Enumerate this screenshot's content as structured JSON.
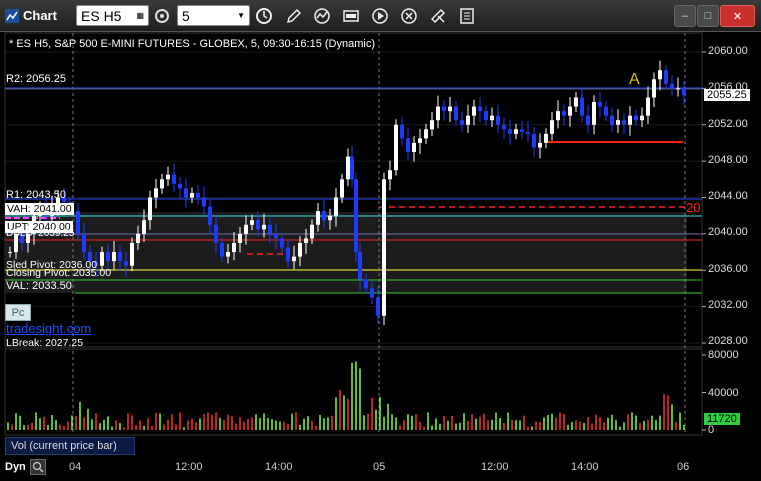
{
  "window": {
    "title": "Chart",
    "symbol": "ES H5",
    "interval": "5"
  },
  "chart": {
    "header": "* ES H5, S&P 500 E-MINI FUTURES - GLOBEX, 5, 09:30-16:15 (Dynamic)",
    "price_axis": [
      "2060.00",
      "2056.00",
      "2052.00",
      "2048.00",
      "2044.00",
      "2040.00",
      "2036.00",
      "2032.00",
      "2028.00"
    ],
    "last_price": "2055.25",
    "volume_axis": [
      "80000",
      "40000",
      "0"
    ],
    "last_volume": "11720",
    "time_axis": [
      "04",
      "12:00",
      "14:00",
      "05",
      "12:00",
      "14:00",
      "06"
    ],
    "marker_A": "A",
    "marker_20": "20",
    "volume_label": "Vol (current price bar)",
    "dyn_label": "Dyn",
    "pc_label": "Pc",
    "watermark": "tradesight.com",
    "levels": {
      "r2": "R2: 2056.25",
      "r1": "R1: 2043.50",
      "vah": "VAH: 2041.00",
      "upt": "UPT: 2040.00",
      "dbld": "DBLD: 2039.25",
      "sled": "Sled Pivot: 2036.00",
      "closing": "Closing Pivot: 2035.00",
      "val": "VAL: 2033.50",
      "lbreak": "LBreak: 2027.25"
    },
    "colors": {
      "bull": "#ffffff",
      "bear": "#1e3cff",
      "r2_line": "#3050ff",
      "red_line": "#ff2020",
      "vah_line": "#ff40ff",
      "upt_line": "#40e0e0",
      "yellow_line": "#ffff40",
      "green_line": "#30d030",
      "vol_up": "#7fff40",
      "vol_down": "#ff3030"
    }
  }
}
